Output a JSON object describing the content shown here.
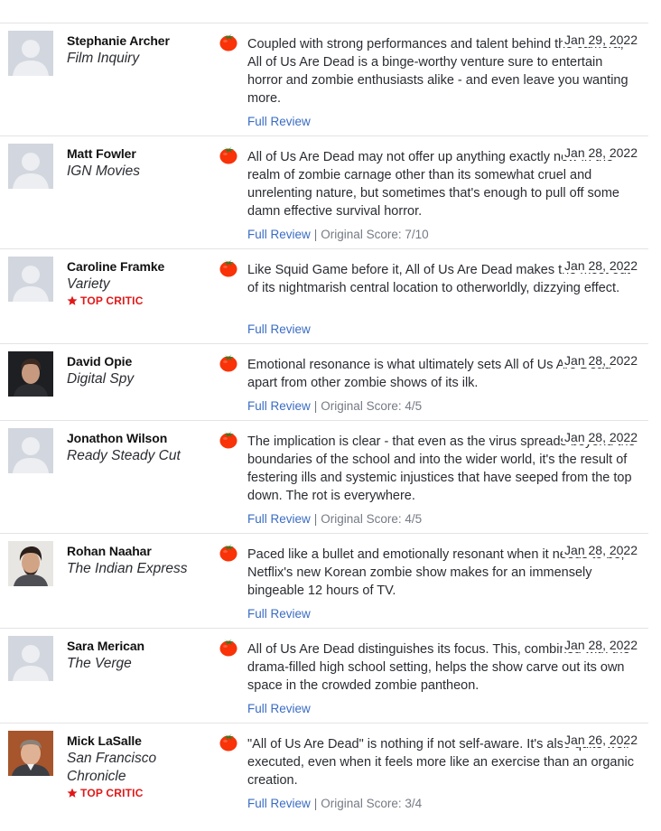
{
  "reviews": [
    {
      "critic": "Stephanie Archer",
      "publication": "Film Inquiry",
      "top_critic": "",
      "avatar": "placeholder",
      "date": "Jan 29, 2022",
      "text": "Coupled with strong performances and talent behind the camera, All of Us Are Dead is a binge-worthy venture sure to entertain horror and zombie enthusiasts alike - and even leave you wanting more.",
      "link": "Full Review",
      "score": ""
    },
    {
      "critic": "Matt Fowler",
      "publication": "IGN Movies",
      "top_critic": "",
      "avatar": "placeholder",
      "date": "Jan 28, 2022",
      "text": "All of Us Are Dead may not offer up anything exactly new in the realm of zombie carnage other than its somewhat cruel and unrelenting nature, but sometimes that's enough to pull off some damn effective survival horror.",
      "link": "Full Review",
      "score": "Original Score: 7/10"
    },
    {
      "critic": "Caroline Framke",
      "publication": "Variety",
      "top_critic": "TOP CRITIC",
      "avatar": "placeholder",
      "date": "Jan 28, 2022",
      "text": "Like Squid Game before it, All of Us Are Dead makes the most out of its nightmarish central location to otherworldly, dizzying effect.",
      "link": "Full Review",
      "score": ""
    },
    {
      "critic": "David Opie",
      "publication": "Digital Spy",
      "top_critic": "",
      "avatar": "photo",
      "date": "Jan 28, 2022",
      "text": "Emotional resonance is what ultimately sets All of Us Are Dead apart from other zombie shows of its ilk.",
      "link": "Full Review",
      "score": "Original Score: 4/5"
    },
    {
      "critic": "Jonathon Wilson",
      "publication": "Ready Steady Cut",
      "top_critic": "",
      "avatar": "placeholder",
      "date": "Jan 28, 2022",
      "text": "The implication is clear - that even as the virus spreads beyond the boundaries of the school and into the wider world, it's the result of festering ills and systemic injustices that have seeped from the top down. The rot is everywhere.",
      "link": "Full Review",
      "score": "Original Score: 4/5"
    },
    {
      "critic": "Rohan Naahar",
      "publication": "The Indian Express",
      "top_critic": "",
      "avatar": "photo",
      "date": "Jan 28, 2022",
      "text": "Paced like a bullet and emotionally resonant when it needs to be, Netflix's new Korean zombie show makes for an immensely bingeable 12 hours of TV.",
      "link": "Full Review",
      "score": ""
    },
    {
      "critic": "Sara Merican",
      "publication": "The Verge",
      "top_critic": "",
      "avatar": "placeholder",
      "date": "Jan 28, 2022",
      "text": "All of Us Are Dead distinguishes its focus. This, combined with the drama-filled high school setting, helps the show carve out its own space in the crowded zombie pantheon.",
      "link": "Full Review",
      "score": ""
    },
    {
      "critic": "Mick LaSalle",
      "publication": "San Francisco Chronicle",
      "top_critic": "TOP CRITIC",
      "avatar": "photo",
      "date": "Jan 26, 2022",
      "text": "\"All of Us Are Dead\" is nothing if not self-aware. It's also quite well executed, even when it feels more like an exercise than an organic creation.",
      "link": "Full Review",
      "score": "Original Score: 3/4"
    }
  ],
  "icons": {
    "fresh": "fresh-tomato-icon",
    "top_critic": "star-icon",
    "placeholder_avatar": "user-silhouette-icon"
  },
  "colors": {
    "link": "#3a6cc4",
    "top_critic": "#e01818",
    "tomato": "#f93208"
  }
}
